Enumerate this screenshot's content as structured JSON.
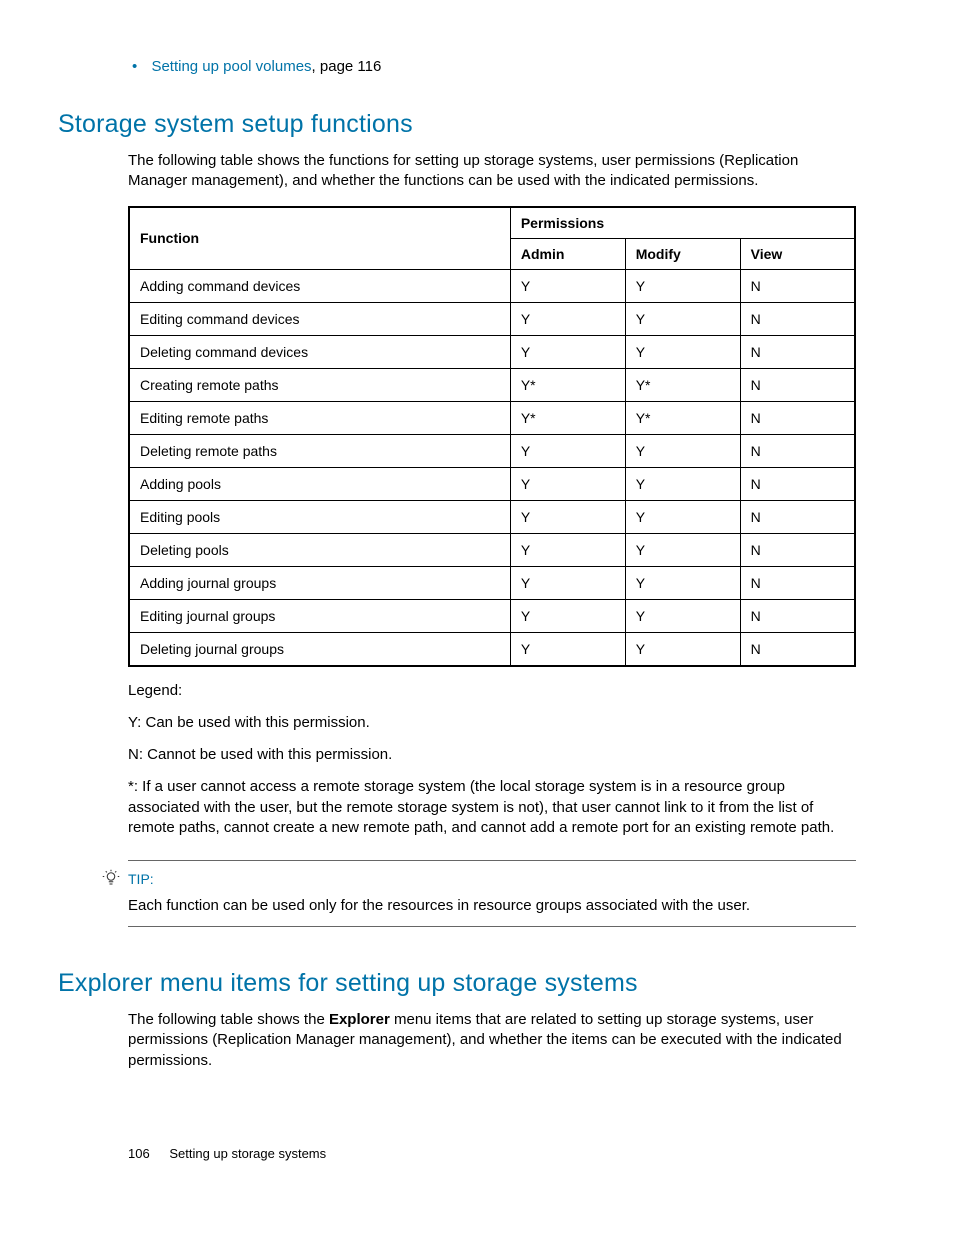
{
  "bullet": {
    "link_text": "Setting up pool volumes",
    "suffix": ", page 116"
  },
  "section1": {
    "title": "Storage system setup functions",
    "intro": "The following table shows the functions for setting up storage systems, user permissions (Replication Manager management), and whether the functions can be used with the indicated permissions."
  },
  "table": {
    "head_function": "Function",
    "head_permissions": "Permissions",
    "head_admin": "Admin",
    "head_modify": "Modify",
    "head_view": "View",
    "rows": [
      {
        "fn": "Adding command devices",
        "admin": "Y",
        "modify": "Y",
        "view": "N"
      },
      {
        "fn": "Editing command devices",
        "admin": "Y",
        "modify": "Y",
        "view": "N"
      },
      {
        "fn": "Deleting command devices",
        "admin": "Y",
        "modify": "Y",
        "view": "N"
      },
      {
        "fn": "Creating remote paths",
        "admin": "Y*",
        "modify": "Y*",
        "view": "N"
      },
      {
        "fn": "Editing remote paths",
        "admin": "Y*",
        "modify": "Y*",
        "view": "N"
      },
      {
        "fn": "Deleting remote paths",
        "admin": "Y",
        "modify": "Y",
        "view": "N"
      },
      {
        "fn": "Adding pools",
        "admin": "Y",
        "modify": "Y",
        "view": "N"
      },
      {
        "fn": "Editing pools",
        "admin": "Y",
        "modify": "Y",
        "view": "N"
      },
      {
        "fn": "Deleting pools",
        "admin": "Y",
        "modify": "Y",
        "view": "N"
      },
      {
        "fn": "Adding journal groups",
        "admin": "Y",
        "modify": "Y",
        "view": "N"
      },
      {
        "fn": "Editing journal groups",
        "admin": "Y",
        "modify": "Y",
        "view": "N"
      },
      {
        "fn": "Deleting journal groups",
        "admin": "Y",
        "modify": "Y",
        "view": "N"
      }
    ]
  },
  "legend": {
    "title": "Legend:",
    "y": "Y: Can be used with this permission.",
    "n": "N: Cannot be used with this permission.",
    "star": "*: If a user cannot access a remote storage system (the local storage system is in a resource group associated with the user, but the remote storage system is not), that user cannot link to it from the list of remote paths, cannot create a new remote path, and cannot add a remote port for an existing remote path."
  },
  "tip": {
    "label": "TIP:",
    "text": "Each function can be used only for the resources in resource groups associated with the user."
  },
  "section2": {
    "title": "Explorer menu items for setting up storage systems",
    "intro_pre": "The following table shows the ",
    "intro_bold": "Explorer",
    "intro_post": " menu items that are related to setting up storage systems, user permissions (Replication Manager management), and whether the items can be executed with the indicated permissions."
  },
  "footer": {
    "page_number": "106",
    "section_name": "Setting up storage systems"
  }
}
